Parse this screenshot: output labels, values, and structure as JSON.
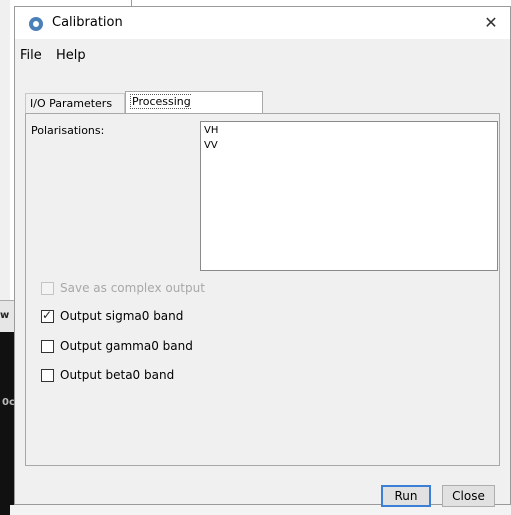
{
  "window": {
    "title": "Calibration",
    "close_glyph": "✕"
  },
  "menu": {
    "items": [
      "File",
      "Help"
    ]
  },
  "tabs": [
    {
      "label": "I/O Parameters",
      "active": false
    },
    {
      "label": "Processing Parameters",
      "active": true
    }
  ],
  "processing": {
    "polarisations_label": "Polarisations:",
    "polarisations": [
      "VH",
      "VV"
    ],
    "options": [
      {
        "label": "Save as complex output",
        "checked": false,
        "enabled": false
      },
      {
        "label": "Output sigma0 band",
        "checked": true,
        "enabled": true
      },
      {
        "label": "Output gamma0 band",
        "checked": false,
        "enabled": true
      },
      {
        "label": "Output beta0 band",
        "checked": false,
        "enabled": true
      }
    ]
  },
  "buttons": {
    "run": "Run",
    "close": "Close"
  },
  "background": {
    "fragment_1": "w",
    "fragment_2": "0c"
  },
  "icons": {
    "app": "calibration-app-icon",
    "close": "close-icon",
    "check": "checkmark-icon"
  },
  "colors": {
    "focus_border": "#3c7fd6",
    "panel_bg": "#f0f0f0"
  }
}
